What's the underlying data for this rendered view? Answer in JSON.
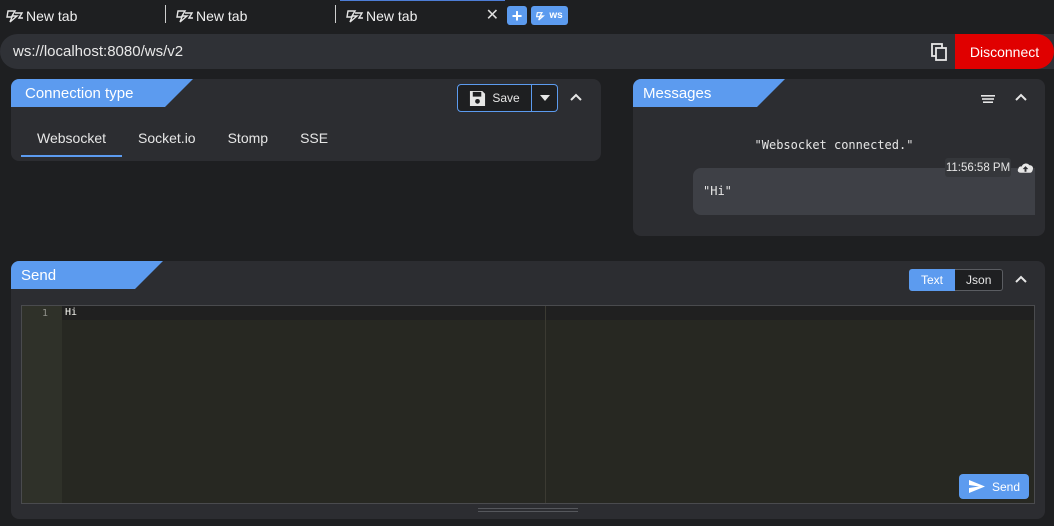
{
  "tabs": [
    {
      "label": "New tab"
    },
    {
      "label": "New tab"
    },
    {
      "label": "New tab"
    }
  ],
  "add_tab": {
    "label": "+"
  },
  "ws_badge": {
    "label": "ws"
  },
  "url": {
    "value": "ws://localhost:8080/ws/v2"
  },
  "disconnect": {
    "label": "Disconnect"
  },
  "connection": {
    "title": "Connection type",
    "save_label": "Save",
    "tabs": [
      {
        "label": "Websocket"
      },
      {
        "label": "Socket.io"
      },
      {
        "label": "Stomp"
      },
      {
        "label": "SSE"
      }
    ]
  },
  "messages": {
    "title": "Messages",
    "system_message": "\"Websocket connected.\"",
    "items": [
      {
        "time": "11:56:58 PM",
        "text": "\"Hi\"",
        "direction": "upload-icon"
      }
    ]
  },
  "send": {
    "title": "Send",
    "formats": [
      {
        "label": "Text"
      },
      {
        "label": "Json"
      }
    ],
    "editor": {
      "line_number": "1",
      "content": "Hi"
    },
    "send_label": "Send"
  },
  "colors": {
    "accent": "#5c9bef",
    "danger": "#e00000",
    "panel": "#2c2d31",
    "background": "#1e1f21"
  }
}
